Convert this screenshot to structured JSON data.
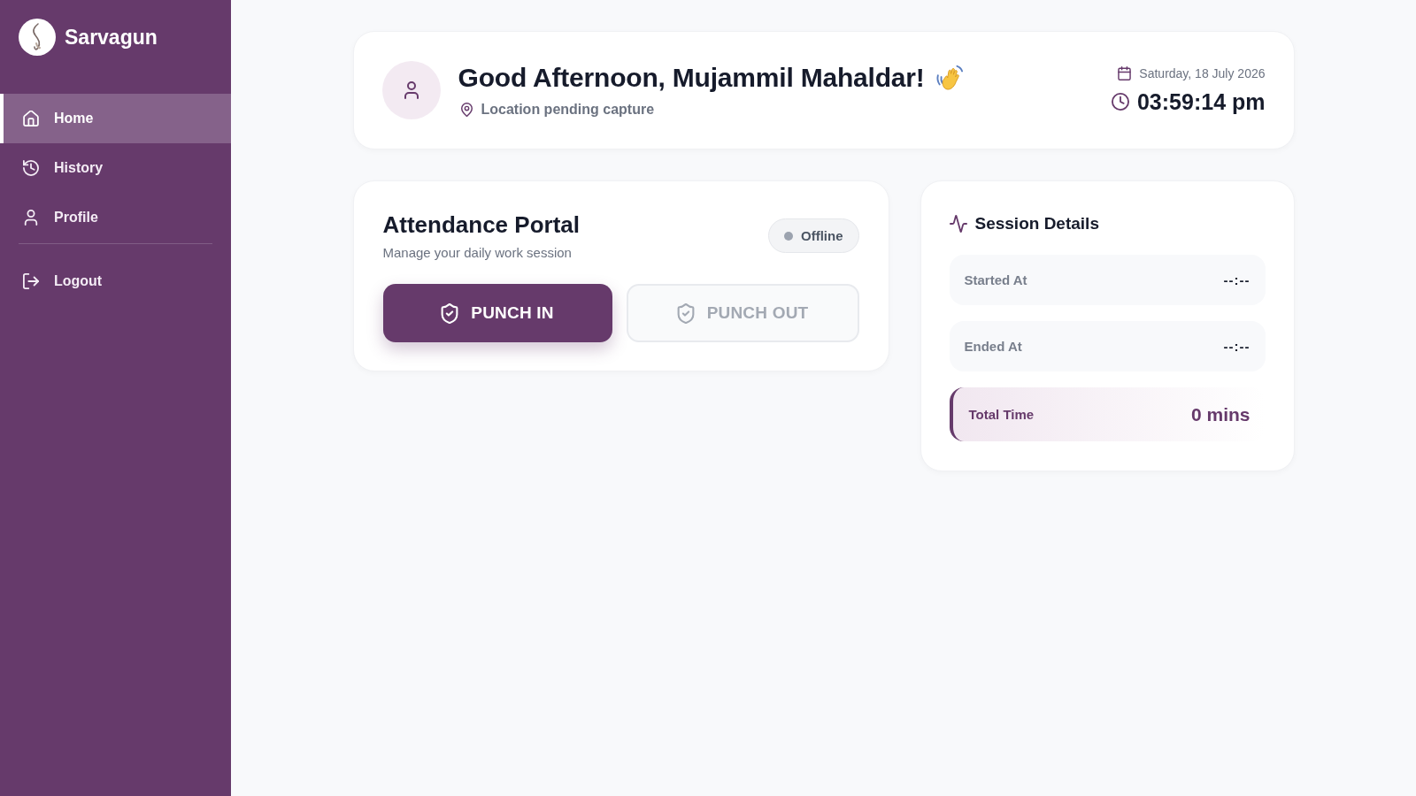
{
  "sidebar": {
    "brand": "Sarvagun",
    "items": [
      {
        "label": "Home",
        "selected": true
      },
      {
        "label": "History",
        "selected": false
      },
      {
        "label": "Profile",
        "selected": false
      }
    ],
    "logout": {
      "label": "Logout"
    }
  },
  "header": {
    "greeting": "Good Afternoon, Mujammil Mahaldar!",
    "location": "Location pending capture",
    "date": "Saturday, 18 July 2026",
    "time": "03:59:14 pm"
  },
  "attendance": {
    "title": "Attendance Portal",
    "subtitle": "Manage your daily work session",
    "status": {
      "label": "Offline",
      "online": false
    },
    "buttons": [
      {
        "label": "PUNCH IN",
        "disabled": false
      },
      {
        "label": "PUNCH OUT",
        "disabled": true
      }
    ]
  },
  "session": {
    "title": "Session Details",
    "rows": [
      {
        "kind": "plain",
        "label": "Started At",
        "value": "--:--"
      },
      {
        "kind": "plain",
        "label": "Ended At",
        "value": "--:--"
      },
      {
        "kind": "total",
        "label": "Total Time",
        "value": "0 mins"
      }
    ]
  }
}
